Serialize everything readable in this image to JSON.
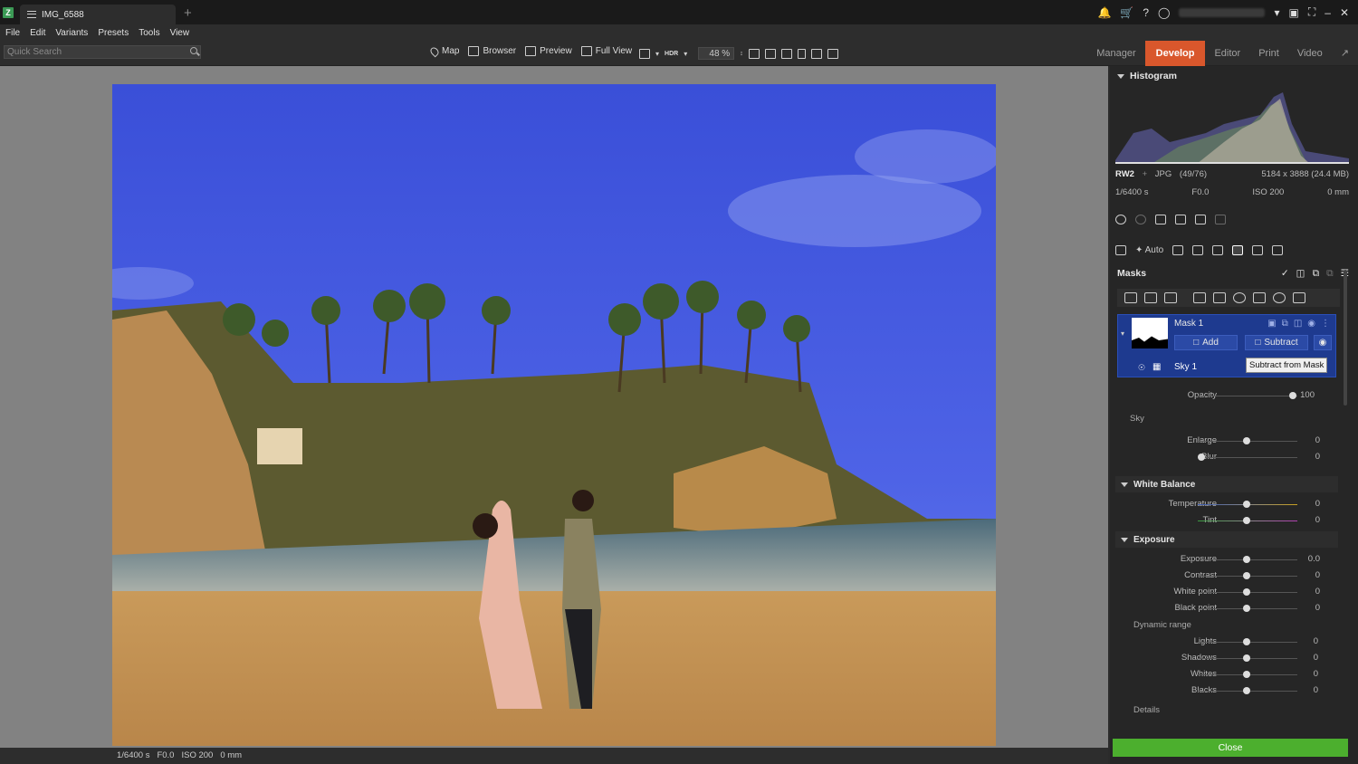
{
  "titlebar": {
    "app_logo": "Z",
    "tab_title": "IMG_6588",
    "tab_add": "+"
  },
  "menubar": {
    "items": [
      "File",
      "Edit",
      "Variants",
      "Presets",
      "Tools",
      "View"
    ]
  },
  "toolbar": {
    "search_placeholder": "Quick Search",
    "views": [
      "Map",
      "Browser",
      "Preview",
      "Full View"
    ],
    "hdr_label": "HDR",
    "zoom": "48 %"
  },
  "modules": [
    "Manager",
    "Develop",
    "Editor",
    "Print",
    "Video"
  ],
  "panel": {
    "histogram_title": "Histogram",
    "format_primary": "RW2",
    "format_plus": "+",
    "format_secondary": "JPG",
    "count": "(49/76)",
    "dimensions": "5184 x 3888 (24.4 MB)",
    "shutter": "1/6400 s",
    "aperture": "F0.0",
    "iso": "ISO 200",
    "focal": "0 mm",
    "auto_label": "Auto",
    "masks_title": "Masks",
    "mask_name": "Mask 1",
    "add_label": "Add",
    "subtract_label": "Subtract",
    "sky_item": "Sky 1",
    "tooltip": "Subtract from Mask",
    "opacity_label": "Opacity",
    "opacity_value": "100",
    "sky_section": "Sky",
    "enlarge_label": "Enlarge",
    "enlarge_value": "0",
    "blur_label": "Blur",
    "blur_value": "0",
    "white_balance_title": "White Balance",
    "temperature_label": "Temperature",
    "temperature_value": "0",
    "tint_label": "Tint",
    "tint_value": "0",
    "exposure_title": "Exposure",
    "exposure_label": "Exposure",
    "exposure_value": "0.0",
    "contrast_label": "Contrast",
    "contrast_value": "0",
    "white_point_label": "White point",
    "white_point_value": "0",
    "black_point_label": "Black point",
    "black_point_value": "0",
    "dynamic_range_label": "Dynamic range",
    "lights_label": "Lights",
    "lights_value": "0",
    "shadows_label": "Shadows",
    "shadows_value": "0",
    "whites_label": "Whites",
    "whites_value": "0",
    "blacks_label": "Blacks",
    "blacks_value": "0",
    "details_label": "Details",
    "close_label": "Close"
  },
  "statusbar": {
    "shutter": "1/6400 s",
    "aperture": "F0.0",
    "iso": "ISO 200",
    "focal": "0 mm"
  },
  "colors": {
    "accent": "#d9572c",
    "mask_selected": "#1e3a8f",
    "close_green": "#4caf2e"
  }
}
